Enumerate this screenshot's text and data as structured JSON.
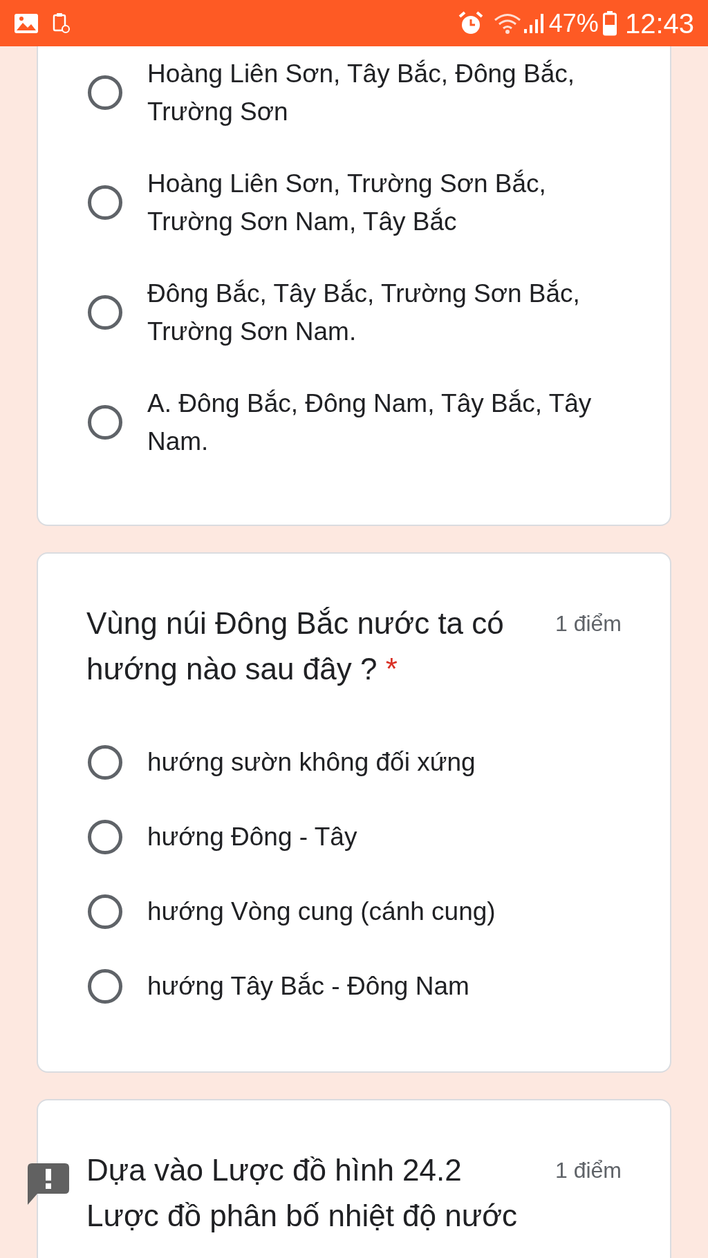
{
  "status_bar": {
    "battery": "47%",
    "time": "12:43"
  },
  "questions": [
    {
      "options": [
        {
          "label": "Hoàng Liên Sơn, Tây Bắc, Đông Bắc, Trường Sơn",
          "selected": false
        },
        {
          "label": "Hoàng Liên Sơn, Trường Sơn Bắc, Trường Sơn Nam, Tây Bắc",
          "selected": false
        },
        {
          "label": "Đông Bắc, Tây Bắc, Trường Sơn Bắc, Trường Sơn Nam.",
          "selected": false
        },
        {
          "label": "A. Đông Bắc, Đông Nam, Tây Bắc, Tây Nam.",
          "selected": false
        }
      ]
    },
    {
      "title": "Vùng núi Đông Bắc nước ta có hướng nào sau đây ?",
      "required_mark": "*",
      "points": "1 điểm",
      "options": [
        {
          "label": "hướng sườn không đối xứng",
          "selected": false
        },
        {
          "label": "hướng Đông - Tây",
          "selected": false
        },
        {
          "label": "hướng Vòng cung (cánh cung)",
          "selected": false
        },
        {
          "label": "hướng Tây Bắc - Đông Nam",
          "selected": false
        }
      ]
    },
    {
      "title": "Dựa vào Lược đồ hình 24.2\nLược đồ phân bố nhiệt độ nước",
      "points": "1 điểm"
    }
  ]
}
